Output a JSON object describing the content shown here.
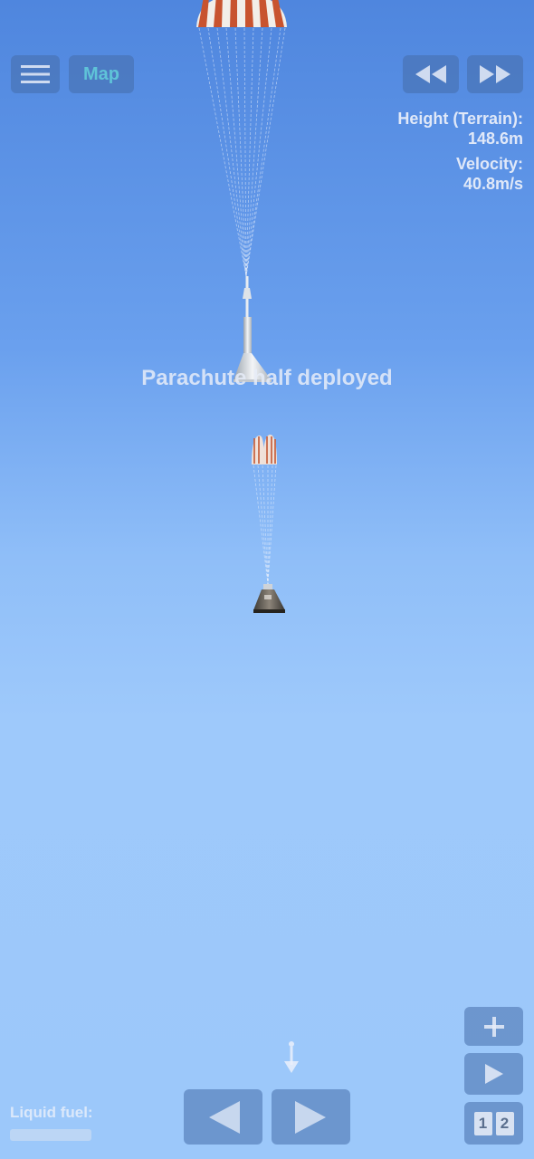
{
  "hud": {
    "menu_icon": "hamburger-icon",
    "map_label": "Map",
    "rewind_icon": "rewind-icon",
    "fast_forward_icon": "fast-forward-icon",
    "height_label": "Height (Terrain):",
    "height_value": "148.6m",
    "velocity_label": "Velocity:",
    "velocity_value": "40.8m/s"
  },
  "message": "Parachute half deployed",
  "fuel": {
    "label": "Liquid fuel:",
    "level": 0
  },
  "controls": {
    "rotate_left_icon": "triangle-left-icon",
    "rotate_right_icon": "triangle-right-icon",
    "direction_icon": "down-arrow-icon",
    "zoom_in_icon": "plus-icon",
    "play_icon": "play-icon",
    "stage_1": "1",
    "stage_2": "2"
  },
  "colors": {
    "sky_top": "#4f86de",
    "sky_bottom": "#9cc8fa",
    "map_text": "#5fc3d8",
    "button_bg": "#466eaa",
    "parachute_red": "#c8532f",
    "parachute_white": "#f2eee9"
  }
}
